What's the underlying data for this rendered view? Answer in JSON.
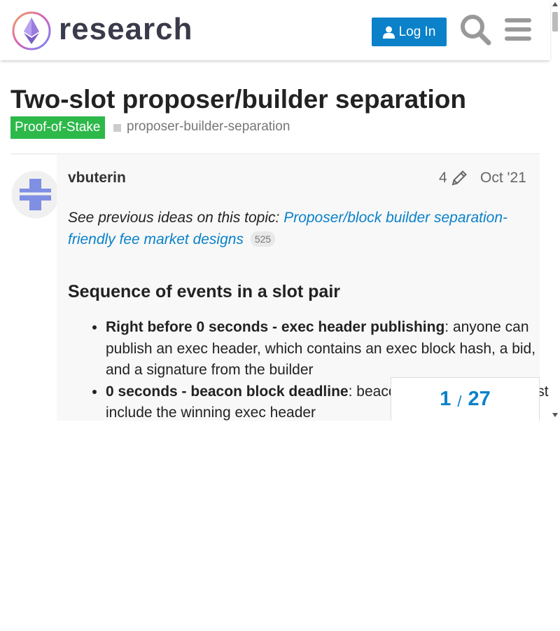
{
  "header": {
    "brand": "research",
    "login_label": "Log In",
    "icons": [
      "ethereum-logo-icon",
      "user-icon",
      "search-icon",
      "hamburger-menu-icon"
    ]
  },
  "topic": {
    "title": "Two-slot proposer/builder separation",
    "category": "Proof-of-Stake",
    "tag": "proposer-builder-separation"
  },
  "post": {
    "author": "vbuterin",
    "edits": "4",
    "date": "Oct '21",
    "intro_text": "See previous ideas on this topic: ",
    "intro_link": "Proposer/block builder separation-friendly fee market designs",
    "link_clicks": "525",
    "heading": "Sequence of events in a slot pair",
    "events": [
      {
        "bold": "Right before 0 seconds - exec header publishing",
        "text": ": anyone can publish an exec header, which contains an exec block hash, a bid, and a signature from the builder"
      },
      {
        "bold": "0 seconds - beacon block deadline",
        "text": ": beacon block proposers must include the winning exec header"
      }
    ]
  },
  "progress": {
    "current": "1",
    "separator": "/",
    "total": "27"
  },
  "colors": {
    "accent": "#0a81c9",
    "category": "#2db84a",
    "post_bg": "#f8f8f8"
  }
}
